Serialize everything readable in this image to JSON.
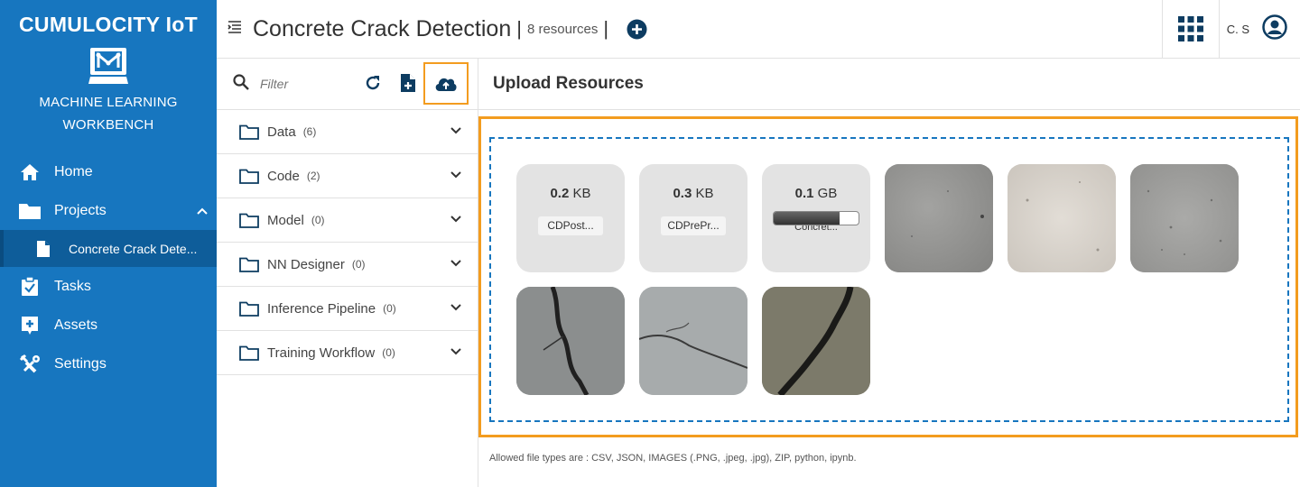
{
  "brand": {
    "name": "CUMULOCITY IoT",
    "app_title_line1": "MACHINE LEARNING",
    "app_title_line2": "WORKBENCH"
  },
  "nav": {
    "home": "Home",
    "projects": "Projects",
    "project_item": "Concrete Crack Dete...",
    "tasks": "Tasks",
    "assets": "Assets",
    "settings": "Settings"
  },
  "header": {
    "title": "Concrete Crack Detection",
    "resources": "8 resources",
    "user": "C. S"
  },
  "panel": {
    "filter_placeholder": "Filter",
    "categories": [
      {
        "label": "Data",
        "count": "(6)"
      },
      {
        "label": "Code",
        "count": "(2)"
      },
      {
        "label": "Model",
        "count": "(0)"
      },
      {
        "label": "NN Designer",
        "count": "(0)"
      },
      {
        "label": "Inference Pipeline",
        "count": "(0)"
      },
      {
        "label": "Training Workflow",
        "count": "(0)"
      }
    ]
  },
  "upload": {
    "title": "Upload Resources",
    "files": [
      {
        "size": "0.2",
        "unit": "KB",
        "name": "CDPost..."
      },
      {
        "size": "0.3",
        "unit": "KB",
        "name": "CDPrePr..."
      },
      {
        "size": "0.1",
        "unit": "GB",
        "name": "Concret...",
        "progress": 0.78
      }
    ],
    "allowed": "Allowed file types are : CSV, JSON, IMAGES (.PNG, .jpeg, .jpg), ZIP, python, ipynb."
  },
  "colors": {
    "sidebar": "#1776bf",
    "highlight": "#f39c1f",
    "dashed": "#1776bf"
  }
}
